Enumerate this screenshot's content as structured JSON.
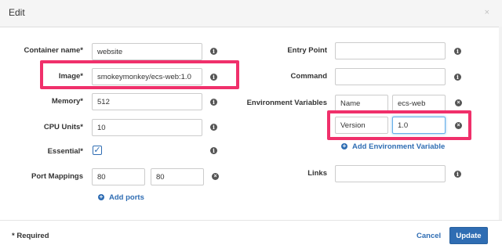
{
  "dialog": {
    "title": "Edit",
    "close_glyph": "×"
  },
  "left": {
    "container_name": {
      "label": "Container name*",
      "value": "website"
    },
    "image": {
      "label": "Image*",
      "value": "smokeymonkey/ecs-web:1.0"
    },
    "memory": {
      "label": "Memory*",
      "value": "512"
    },
    "cpu_units": {
      "label": "CPU Units*",
      "value": "10"
    },
    "essential": {
      "label": "Essential*",
      "checked": true,
      "check_glyph": "✓"
    },
    "port_mappings": {
      "label": "Port Mappings",
      "host_port": "80",
      "container_port": "80"
    },
    "add_ports_label": "Add ports"
  },
  "right": {
    "entry_point": {
      "label": "Entry Point",
      "value": ""
    },
    "command": {
      "label": "Command",
      "value": ""
    },
    "env_vars": {
      "label": "Environment Variables",
      "rows": [
        {
          "key": "Name",
          "value": "ecs-web"
        },
        {
          "key": "Version",
          "value": "1.0"
        }
      ],
      "add_label": "Add Environment Variable"
    },
    "links": {
      "label": "Links",
      "value": ""
    }
  },
  "icons": {
    "info": "i",
    "remove": "×",
    "add": "+"
  },
  "footer": {
    "required_note": "* Required",
    "cancel_label": "Cancel",
    "update_label": "Update"
  },
  "colors": {
    "highlight": "#f0306b",
    "accent": "#2f6db3"
  }
}
